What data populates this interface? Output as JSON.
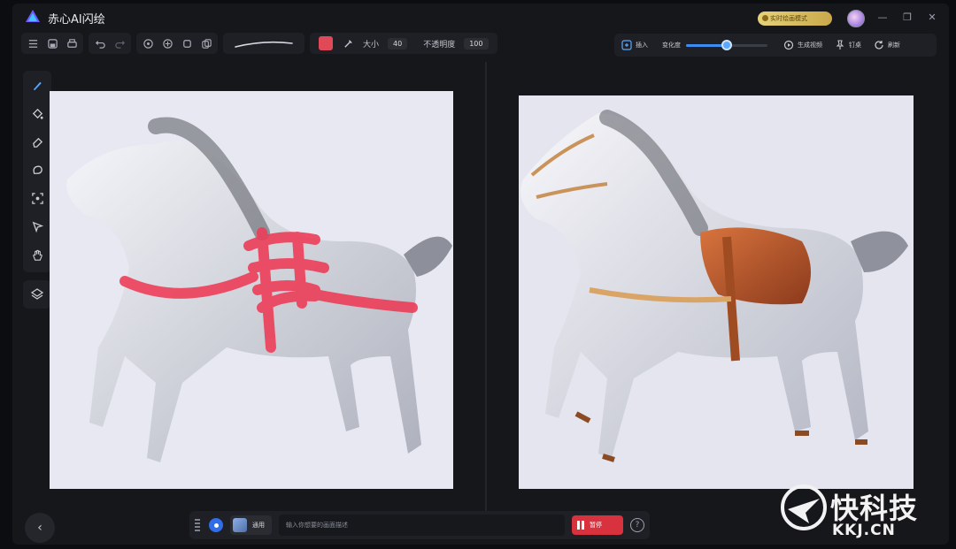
{
  "app": {
    "title": "赤心AI闪绘"
  },
  "titlebar": {
    "mode_pill": "实时绘画模式",
    "controls": [
      "minimize-icon",
      "restore-icon",
      "close-icon"
    ]
  },
  "toolbar": {
    "size_label": "大小",
    "size_value": "40",
    "opacity_label": "不透明度",
    "opacity_value": "100",
    "brush_color": "#e04a58"
  },
  "right_toolbar": {
    "insert_label": "插入",
    "variation_label": "变化度",
    "variation_level": 0.5,
    "generate_video_label": "生成视频",
    "pin_label": "钉桌",
    "refresh_label": "刷新"
  },
  "rail": {
    "tools": [
      "brush-icon",
      "fill-icon",
      "eraser-icon",
      "lasso-icon",
      "select-icon",
      "pointer-icon",
      "hand-icon"
    ],
    "layers": "layers-icon"
  },
  "prompt": {
    "mode_label": "通用",
    "placeholder": "输入你想要的画面描述",
    "generate_label": "暂停"
  },
  "watermark": {
    "brand": "快科技",
    "domain": "KKJ.CN"
  },
  "colors": {
    "accent": "#3d8cf0",
    "danger": "#d8323f",
    "background": "#16171b"
  }
}
